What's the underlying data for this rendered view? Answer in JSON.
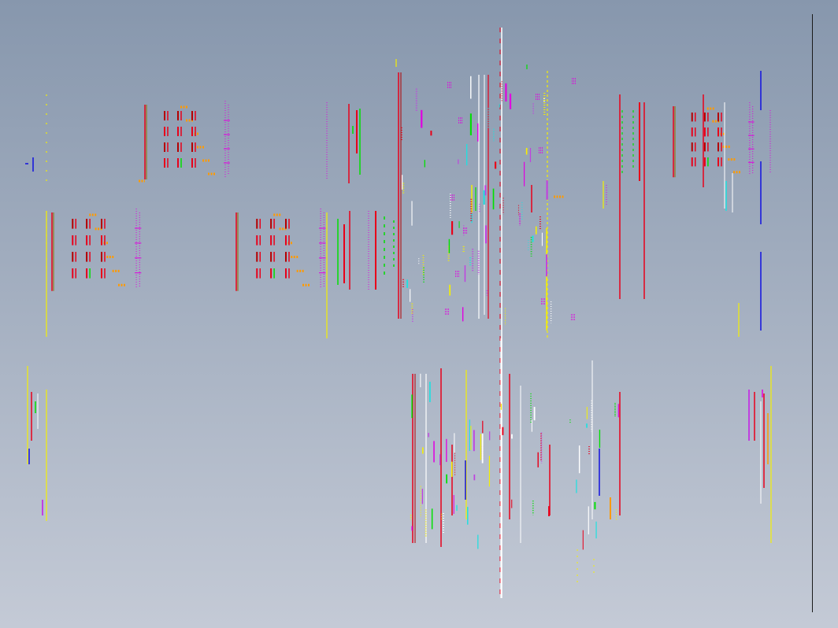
{
  "viewport": {
    "background_top": "#8797ad",
    "background_bottom": "#c4cad6"
  },
  "palette": {
    "red": "#e8001a",
    "dark_red": "#b40000",
    "yellow": "#f5f000",
    "green": "#00e000",
    "magenta": "#e000e0",
    "purple": "#c040e0",
    "white": "#ffffff",
    "blue": "#1010e0",
    "cyan": "#20e0e0",
    "orange": "#ff9a00",
    "olive": "#8a7000",
    "border": "#1a1a1a"
  }
}
